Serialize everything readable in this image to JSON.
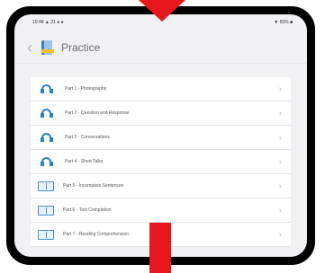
{
  "status": {
    "left": "10:46  ▲ 21 ● ●",
    "right": "▼ 65% ■"
  },
  "nav": {
    "back": "‹",
    "title": "Practice"
  },
  "items": [
    {
      "label": "Part 1 - Photographs",
      "icon": "headphones-icon"
    },
    {
      "label": "Part 2 - Question and Response",
      "icon": "headphones-icon"
    },
    {
      "label": "Part 3 - Conversations",
      "icon": "headphones-icon"
    },
    {
      "label": "Part 4 - Short Talks",
      "icon": "headphones-icon"
    },
    {
      "label": "Part 5 - Incomplete Sentences",
      "icon": "book-icon"
    },
    {
      "label": "Part 6 - Text Completion",
      "icon": "book-icon"
    },
    {
      "label": "Part 7 - Reading Comprehension",
      "icon": "book-icon"
    }
  ],
  "chevron": "›",
  "colors": {
    "annotation": "#e8171d",
    "accent": "#2c81c6",
    "book_cover": "#3c7fc3",
    "book_band": "#f4c20d"
  }
}
